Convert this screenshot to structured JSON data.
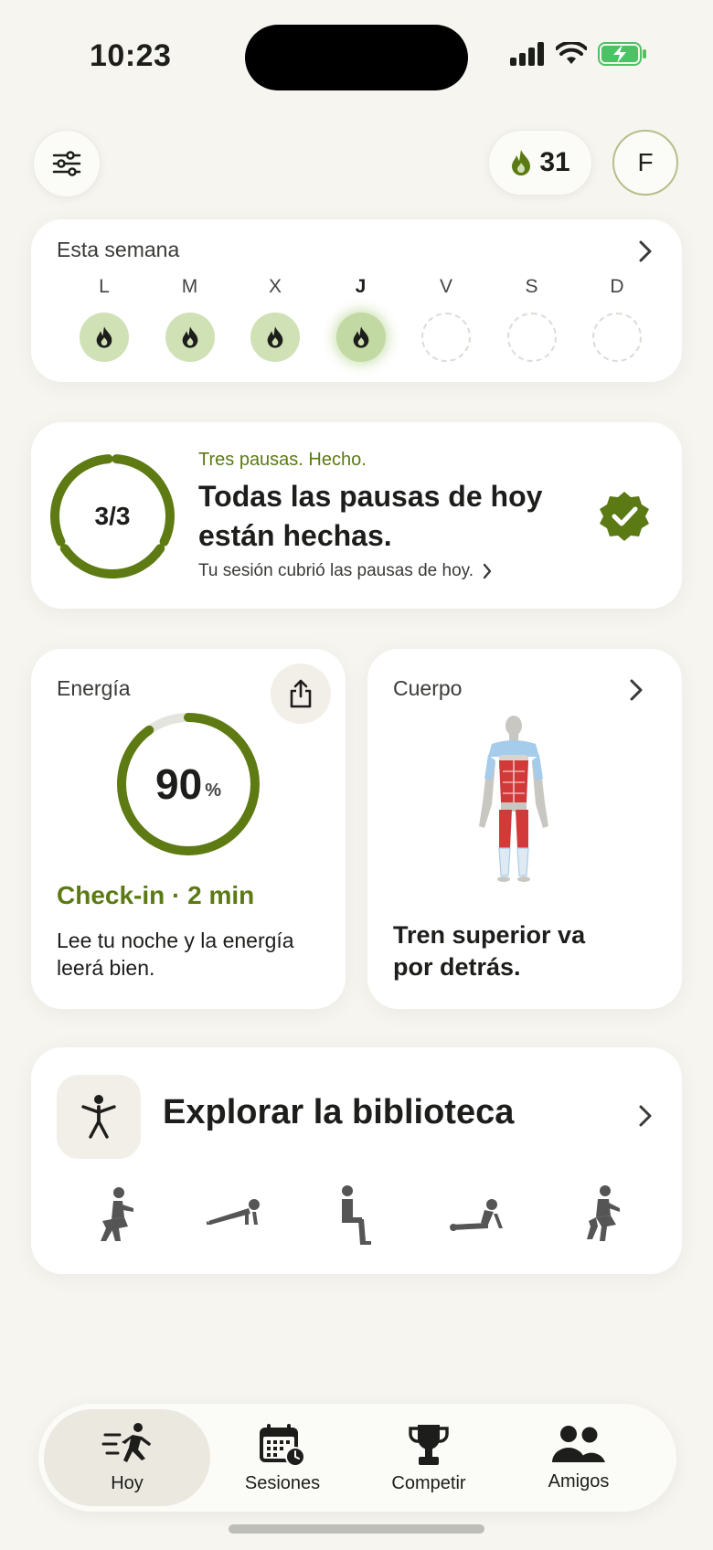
{
  "status_bar": {
    "time": "10:23"
  },
  "header": {
    "streak_count": "31",
    "avatar_initial": "F"
  },
  "week": {
    "title": "Esta semana",
    "days": [
      {
        "letter": "L",
        "state": "done"
      },
      {
        "letter": "M",
        "state": "done"
      },
      {
        "letter": "X",
        "state": "done"
      },
      {
        "letter": "J",
        "state": "today"
      },
      {
        "letter": "V",
        "state": "empty"
      },
      {
        "letter": "S",
        "state": "empty"
      },
      {
        "letter": "D",
        "state": "empty"
      }
    ]
  },
  "pauses": {
    "progress_label": "3/3",
    "completed": 3,
    "total": 3,
    "kicker": "Tres pausas. Hecho.",
    "headline_line1": "Todas las pausas de hoy",
    "headline_line2": "están hechas.",
    "subline": "Tu sesión cubrió las pausas de hoy."
  },
  "energy": {
    "title": "Energía",
    "value": "90",
    "unit": "%",
    "level": 0.9,
    "checkin": "Check-in · 2 min",
    "desc_line1": "Lee tu noche y la energía",
    "desc_line2": "leerá bien."
  },
  "body": {
    "title": "Cuerpo",
    "desc_line1": "Tren superior va",
    "desc_line2": "por detrás."
  },
  "library": {
    "title": "Explorar la biblioteca",
    "exercises": [
      "squat-figure",
      "plank-figure",
      "wall-sit-figure",
      "cobra-figure",
      "jump-squat-figure"
    ]
  },
  "nav": {
    "items": [
      {
        "label": "Hoy",
        "icon": "runner-icon",
        "active": true
      },
      {
        "label": "Sesiones",
        "icon": "calendar-icon",
        "active": false
      },
      {
        "label": "Competir",
        "icon": "trophy-icon",
        "active": false
      },
      {
        "label": "Amigos",
        "icon": "friends-icon",
        "active": false
      }
    ]
  },
  "colors": {
    "accent": "#5b7a14",
    "ring": "#5e7a12",
    "day_done": "#cfe1b5",
    "background": "#f6f5f0"
  }
}
